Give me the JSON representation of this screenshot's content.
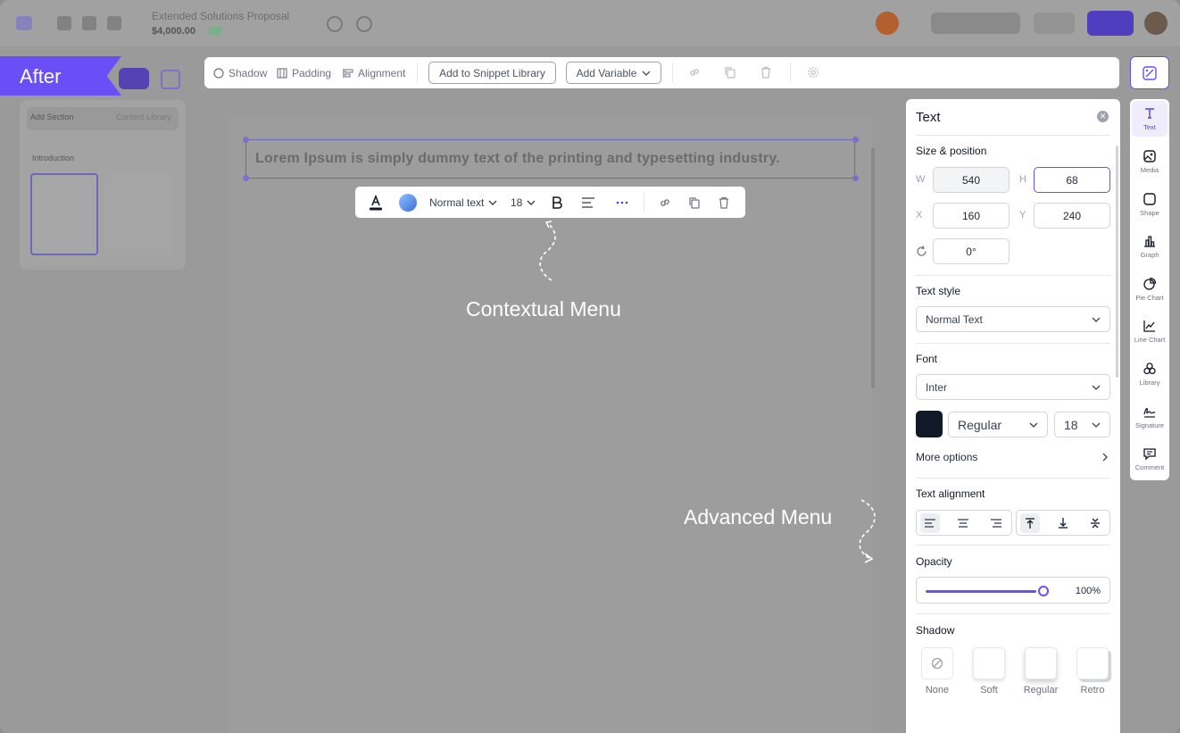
{
  "header": {
    "doc_title": "Extended Solutions Proposal",
    "doc_price": "$4,000.00"
  },
  "overlay": {
    "after_label": "After"
  },
  "left_panel": {
    "tab_active": "Add Section",
    "tab_other": "Content Library",
    "section_name": "Introduction"
  },
  "canvas": {
    "text": "Lorem Ipsum is simply dummy text of the printing and typesetting industry."
  },
  "top_toolbar": {
    "shadow": "Shadow",
    "padding": "Padding",
    "alignment": "Alignment",
    "add_snippet": "Add to Snippet Library",
    "add_variable": "Add Variable"
  },
  "context_menu": {
    "text_style": "Normal text",
    "font_size": "18",
    "gradient_color": "#4f8fe8"
  },
  "callouts": {
    "contextual": "Contextual Menu",
    "advanced": "Advanced Menu"
  },
  "advanced": {
    "title": "Text",
    "size_position_label": "Size & position",
    "w_label": "W",
    "w_value": "540",
    "h_label": "H",
    "h_value": "68",
    "x_label": "X",
    "x_value": "160",
    "y_label": "Y",
    "y_value": "240",
    "rotation_value": "0°",
    "text_style_label": "Text style",
    "text_style_value": "Normal Text",
    "font_label": "Font",
    "font_value": "Inter",
    "font_color": "#111827",
    "font_weight_value": "Regular",
    "font_size_value": "18",
    "more_options": "More options",
    "text_alignment_label": "Text alignment",
    "opacity_label": "Opacity",
    "opacity_value": "100%",
    "opacity_fraction": 1.0,
    "shadow_label": "Shadow",
    "shadow_options": [
      "None",
      "Soft",
      "Regular",
      "Retro"
    ]
  },
  "rail": {
    "items": [
      "Text",
      "Media",
      "Shape",
      "Graph",
      "Pie Chart",
      "Line Chart",
      "Library",
      "Signature",
      "Comment"
    ]
  },
  "colors": {
    "accent": "#6a4ff7",
    "overlay_dim": "#9a9a9a"
  }
}
